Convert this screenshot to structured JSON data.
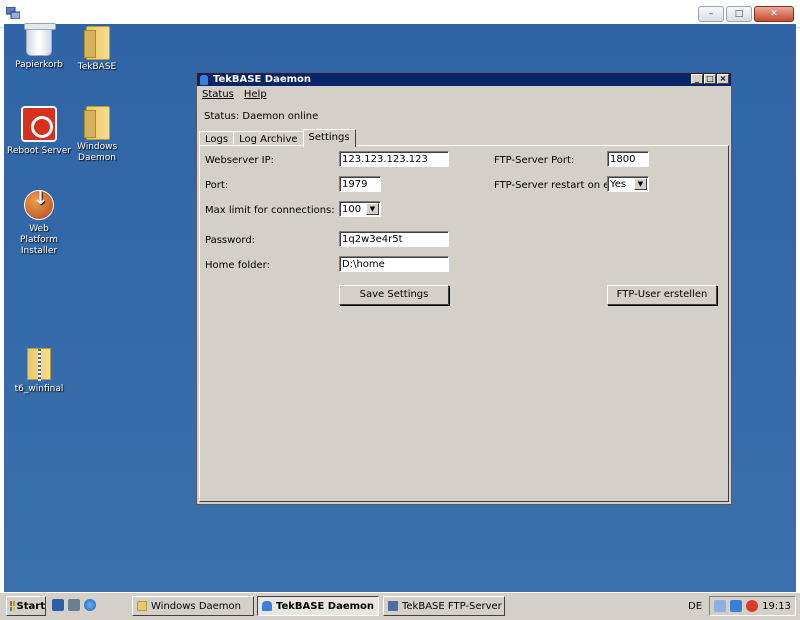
{
  "desktop": {
    "icons": [
      {
        "label": "Papierkorb"
      },
      {
        "label": "TekBASE"
      },
      {
        "label": "Reboot Server"
      },
      {
        "label": "Windows Daemon"
      },
      {
        "label": "Web Platform Installer"
      },
      {
        "label": "t6_winfinal"
      }
    ]
  },
  "window": {
    "title": "TekBASE Daemon",
    "menu": [
      "Status",
      "Help"
    ],
    "status_text": "Status: Daemon online",
    "tabs": [
      "Logs",
      "Log Archive",
      "Settings"
    ],
    "active_tab": "Settings"
  },
  "settings": {
    "webserver_ip_label": "Webserver IP:",
    "webserver_ip_value": "123.123.123.123",
    "port_label": "Port:",
    "port_value": "1979",
    "max_conn_label": "Max limit for connections:",
    "max_conn_value": "100",
    "password_label": "Password:",
    "password_value": "1q2w3e4r5t",
    "home_folder_label": "Home folder:",
    "home_folder_value": "D:\\home",
    "ftp_port_label": "FTP-Server Port:",
    "ftp_port_value": "1800",
    "ftp_restart_label": "FTP-Server restart on exit:",
    "ftp_restart_value": "Yes",
    "save_button": "Save Settings",
    "ftp_user_button": "FTP-User erstellen"
  },
  "taskbar": {
    "start_label": "Start",
    "tasks": [
      "Windows Daemon",
      "TekBASE Daemon",
      "TekBASE FTP-Server"
    ],
    "active_task": "TekBASE Daemon",
    "language": "DE",
    "clock": "19:13"
  },
  "colors": {
    "desktop": "#3a6ea5",
    "titlebar": "#0a246a",
    "window_face": "#d4d0c8"
  }
}
